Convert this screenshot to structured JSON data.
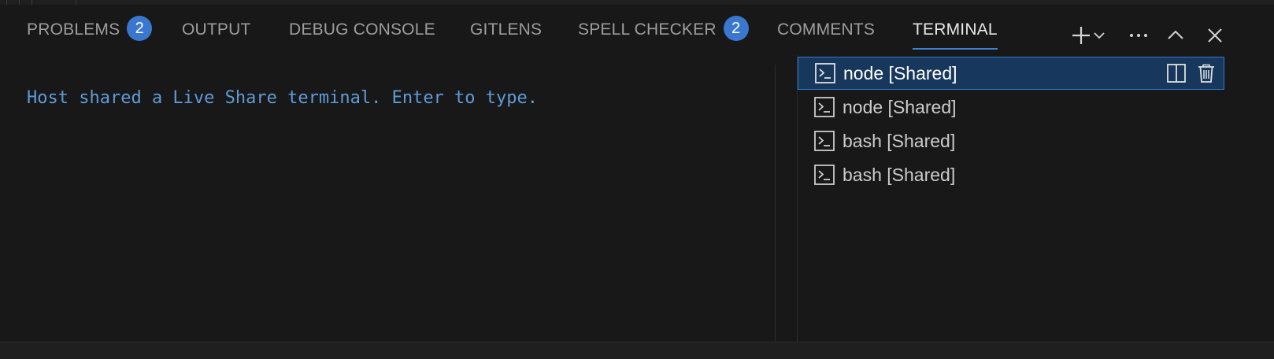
{
  "tabs": [
    {
      "label": "PROBLEMS",
      "badge": "2"
    },
    {
      "label": "OUTPUT"
    },
    {
      "label": "DEBUG CONSOLE"
    },
    {
      "label": "GITLENS"
    },
    {
      "label": "SPELL CHECKER",
      "badge": "2"
    },
    {
      "label": "COMMENTS"
    },
    {
      "label": "TERMINAL",
      "active": true
    }
  ],
  "actions": [
    "plus-icon",
    "chevron-down-icon",
    "ellipsis-icon",
    "chevron-up-icon",
    "close-icon"
  ],
  "terminal": {
    "message": "Host shared a Live Share terminal. Enter to type."
  },
  "terminal_list": [
    {
      "label": "node [Shared]",
      "selected": true
    },
    {
      "label": "node [Shared]"
    },
    {
      "label": "bash [Shared]"
    },
    {
      "label": "bash [Shared]"
    }
  ],
  "item_actions": [
    "split-terminal-icon",
    "trash-icon"
  ],
  "colors": {
    "background": "#181818",
    "accent": "#3b83d6",
    "badge": "#3a78d0",
    "selection": "#17375c",
    "terminal_text": "#5e9bd8"
  }
}
